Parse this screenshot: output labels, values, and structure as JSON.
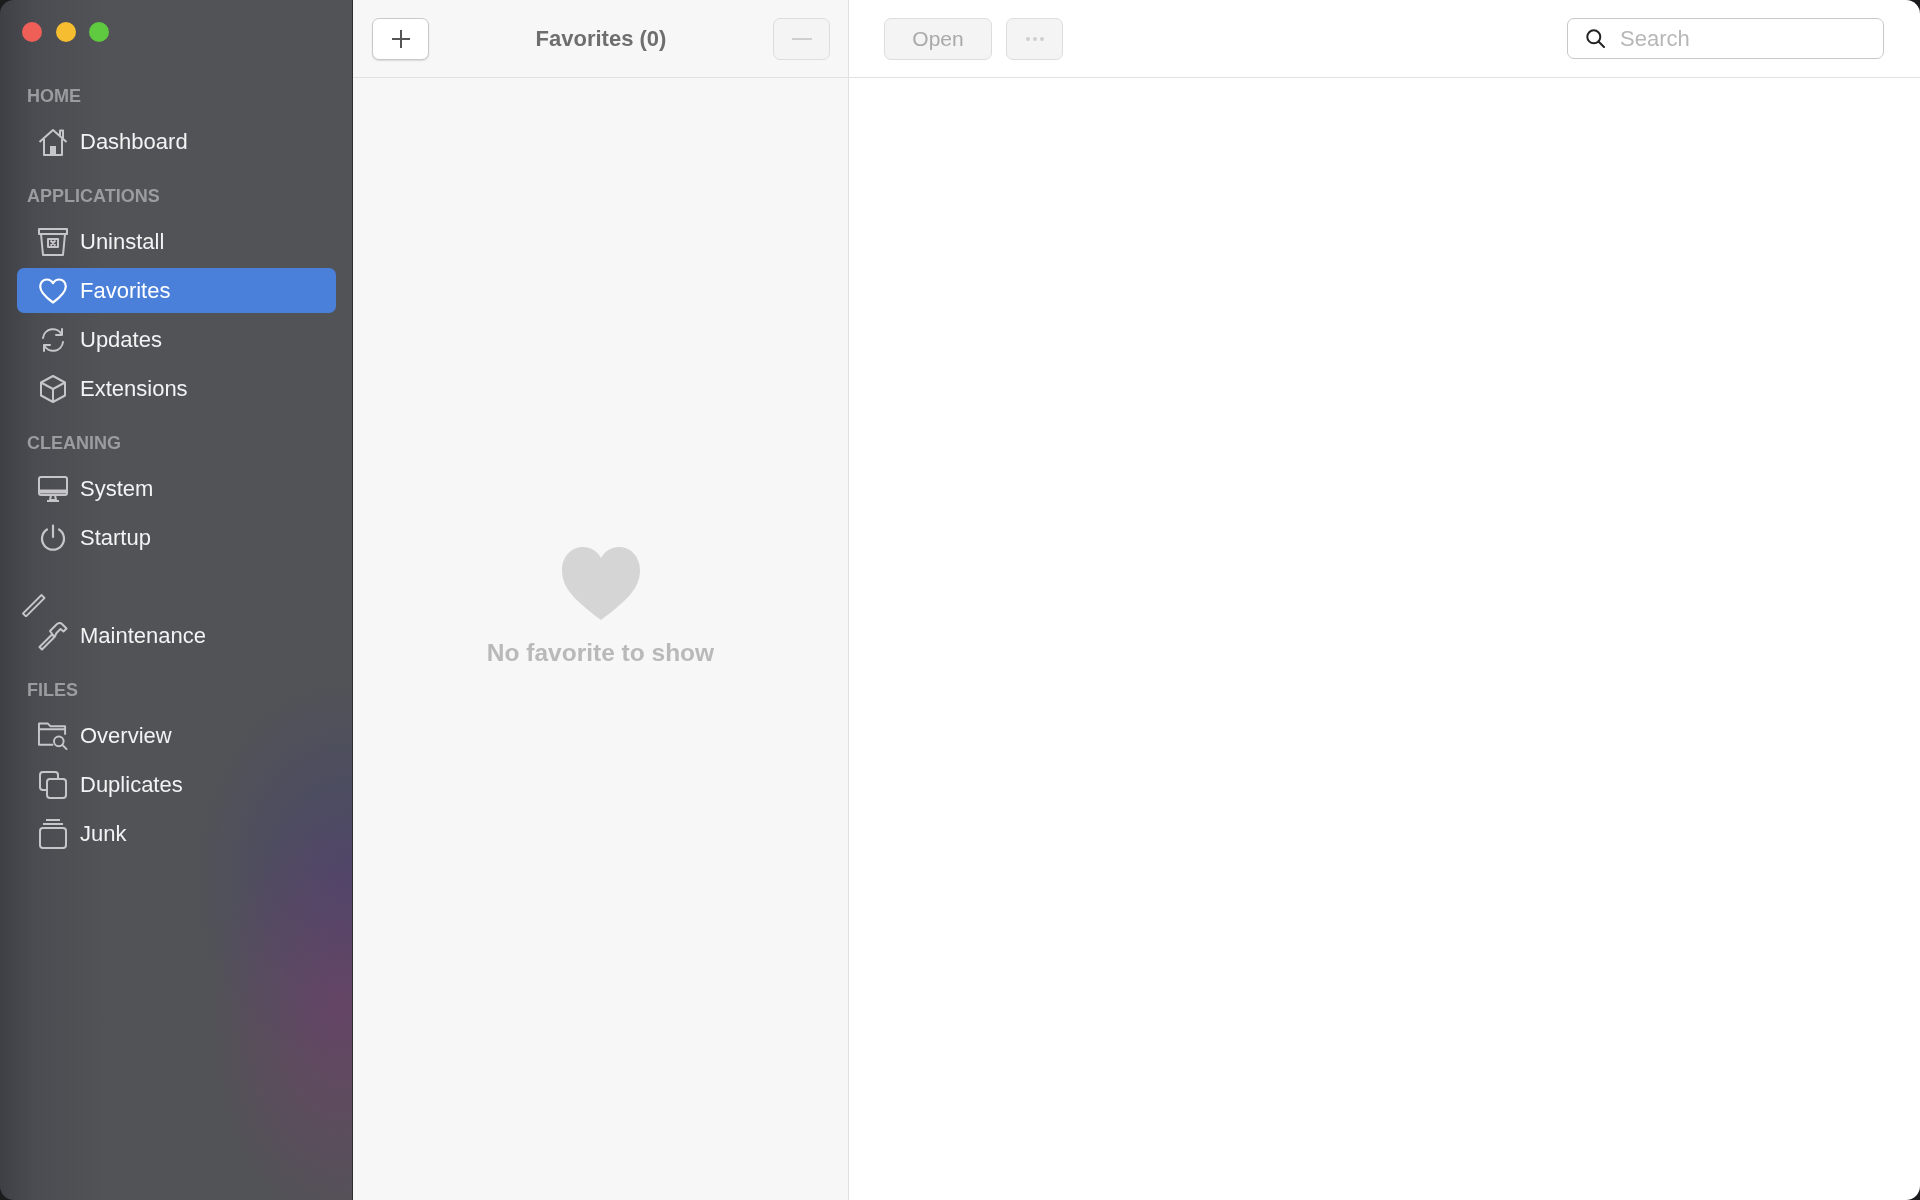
{
  "sidebar": {
    "sections": [
      {
        "title": "HOME",
        "items": [
          {
            "kind": "entry",
            "label": "Dashboard",
            "selected": false
          }
        ]
      },
      {
        "title": "APPLICATIONS",
        "items": [
          {
            "kind": "entry",
            "label": "Uninstall",
            "selected": false
          },
          {
            "kind": "entry",
            "label": "Favorites",
            "selected": true
          },
          {
            "kind": "entry",
            "label": "Updates",
            "selected": false
          },
          {
            "kind": "entry",
            "label": "Extensions",
            "selected": false
          }
        ]
      },
      {
        "title": "CLEANING",
        "items": [
          {
            "kind": "entry",
            "label": "System",
            "selected": false
          },
          {
            "kind": "entry",
            "label": "Startup",
            "selected": false
          },
          {
            "kind": "drag_placeholder"
          },
          {
            "kind": "entry",
            "label": "Maintenance",
            "selected": false
          }
        ]
      },
      {
        "title": "FILES",
        "items": [
          {
            "kind": "entry",
            "label": "Overview",
            "selected": false
          },
          {
            "kind": "entry",
            "label": "Duplicates",
            "selected": false
          },
          {
            "kind": "entry",
            "label": "Junk",
            "selected": false
          }
        ]
      }
    ]
  },
  "list_toolbar": {
    "add_button": {
      "disabled": false
    },
    "title": "Favorites (0)",
    "remove_button": {
      "disabled": true
    }
  },
  "empty_state": {
    "message": "No favorite to show"
  },
  "detail_toolbar": {
    "open_button": {
      "label": "Open",
      "disabled": true
    },
    "more_button": {
      "disabled": true
    },
    "search": {
      "placeholder": "Search"
    }
  }
}
